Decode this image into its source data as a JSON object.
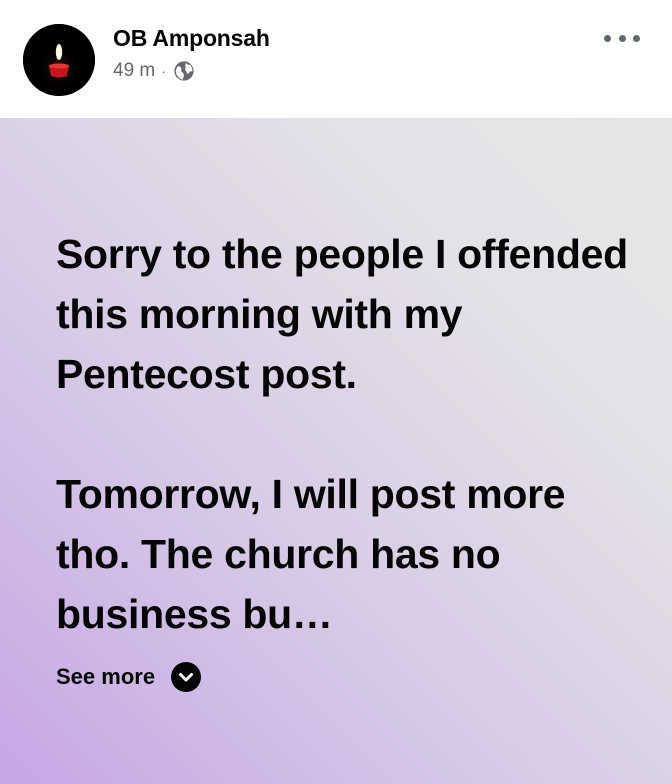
{
  "post": {
    "author": {
      "name": "OB Amponsah",
      "avatar_icon": "candle-avatar-icon"
    },
    "meta": {
      "time": "49 m",
      "separator": "·",
      "audience_icon": "globe-icon"
    },
    "menu_icon": "more-horizontal-icon",
    "body": {
      "paragraphs": [
        "Sorry to the people I offended this morning with my Pentecost post.",
        "Tomorrow, I will post more tho. The church has no business bu…"
      ],
      "see_more_label": "See more",
      "see_more_icon": "chevron-down-icon",
      "background_gradient": [
        "#c6a6e6",
        "#e6e6e6"
      ]
    }
  }
}
